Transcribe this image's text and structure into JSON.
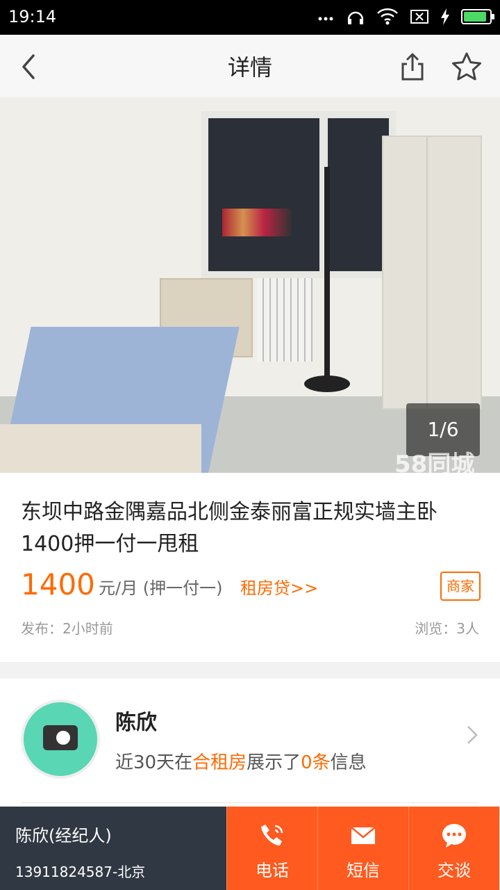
{
  "status_bar": {
    "time": "19:14"
  },
  "header": {
    "title": "详情"
  },
  "gallery": {
    "counter": "1/6",
    "watermark": "58同城"
  },
  "listing": {
    "title": "东坝中路金隅嘉品北侧金泰丽富正规实墙主卧1400押一付一甩租",
    "price": "1400",
    "price_unit": "元/月 (押一付一)",
    "loan_link": "租房贷>>",
    "badge": "商家",
    "published": "发布：2小时前",
    "views": "浏览：3人"
  },
  "agent": {
    "name": "陈欣",
    "stats_prefix": "近30天在",
    "stats_category": "合租房",
    "stats_mid": "展示了",
    "stats_count": "0条",
    "stats_suffix": "信息"
  },
  "bottom_bar": {
    "contact_name": "陈欣(经纪人)",
    "contact_phone": "13911824587-北京",
    "call_label": "电话",
    "sms_label": "短信",
    "chat_label": "交谈"
  },
  "colors": {
    "accent": "#ff6a00",
    "action_bg": "#ff5a1f",
    "contact_bg": "#303843"
  }
}
